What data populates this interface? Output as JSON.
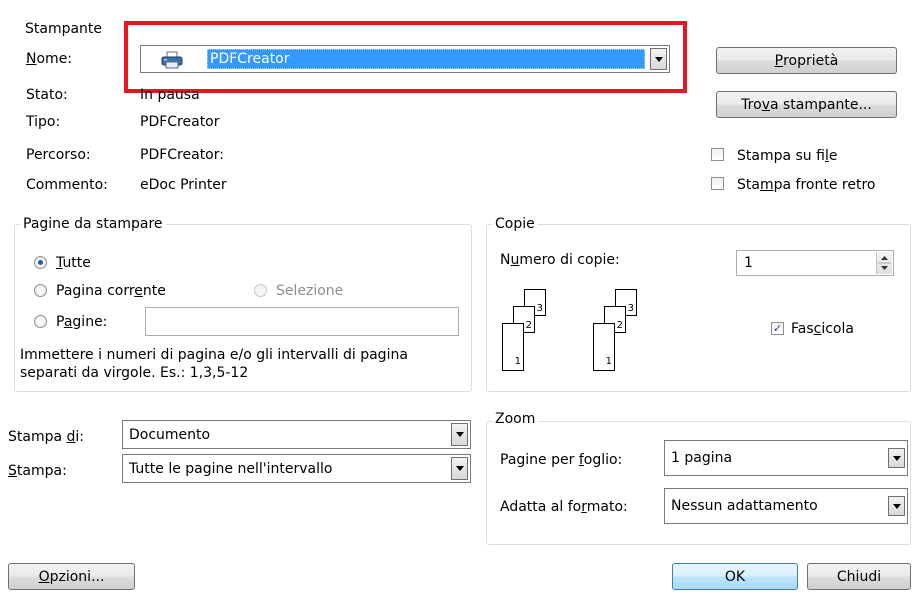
{
  "printer": {
    "group_title": "Stampante",
    "name_label_pre": "",
    "name_label_u": "N",
    "name_label_post": "ome:",
    "name_value": "PDFCreator",
    "status_label": "Stato:",
    "status_value": "In pausa",
    "type_label": "Tipo:",
    "type_value": "PDFCreator",
    "path_label": "Percorso:",
    "path_value": "PDFCreator:",
    "comment_label": "Commento:",
    "comment_value": "eDoc Printer",
    "properties_pre": "",
    "properties_u": "P",
    "properties_post": "roprietà",
    "find_pre": "Tro",
    "find_u": "v",
    "find_post": "a stampante...",
    "print_to_file_pre": "Stampa su fi",
    "print_to_file_u": "l",
    "print_to_file_post": "e",
    "duplex_pre": "Sta",
    "duplex_u": "m",
    "duplex_post": "pa fronte retro"
  },
  "range": {
    "group_title": "Pagine da stampare",
    "all_pre": "",
    "all_u": "T",
    "all_post": "utte",
    "current_pre": "Pagina corr",
    "current_u": "e",
    "current_post": "nte",
    "selection": "Selezione",
    "pages_pre": "P",
    "pages_u": "a",
    "pages_post": "gine:",
    "pages_value": "",
    "hint_line1": "Immettere i numeri di pagina e/o gli intervalli di pagina",
    "hint_line2": "separati da virgole. Es.: 1,3,5-12"
  },
  "copies": {
    "group_title": "Copie",
    "number_label_pre": "N",
    "number_label_u": "u",
    "number_label_post": "mero di copie:",
    "number_value": "1",
    "collate_pre": "Fas",
    "collate_u": "c",
    "collate_post": "icola",
    "collate_checked": "✓",
    "page_labels": [
      "1",
      "2",
      "3"
    ]
  },
  "print_what": {
    "label_pre": "Stampa ",
    "label_u": "d",
    "label_post": "i:",
    "value": "Documento",
    "print_label_pre": "",
    "print_label_u": "S",
    "print_label_post": "tampa:",
    "print_value": "Tutte le pagine nell'intervallo"
  },
  "zoom": {
    "group_title": "Zoom",
    "per_sheet_pre": "Pagine per ",
    "per_sheet_u": "f",
    "per_sheet_post": "oglio:",
    "per_sheet_value": "1 pagina",
    "scale_pre": "Adatta al fo",
    "scale_u": "r",
    "scale_post": "mato:",
    "scale_value": "Nessun adattamento"
  },
  "footer": {
    "options_pre": "",
    "options_u": "O",
    "options_post": "pzioni...",
    "ok": "OK",
    "close": "Chiudi"
  },
  "colors": {
    "highlight": "#3399ff",
    "annotation_red": "#e8141e"
  }
}
